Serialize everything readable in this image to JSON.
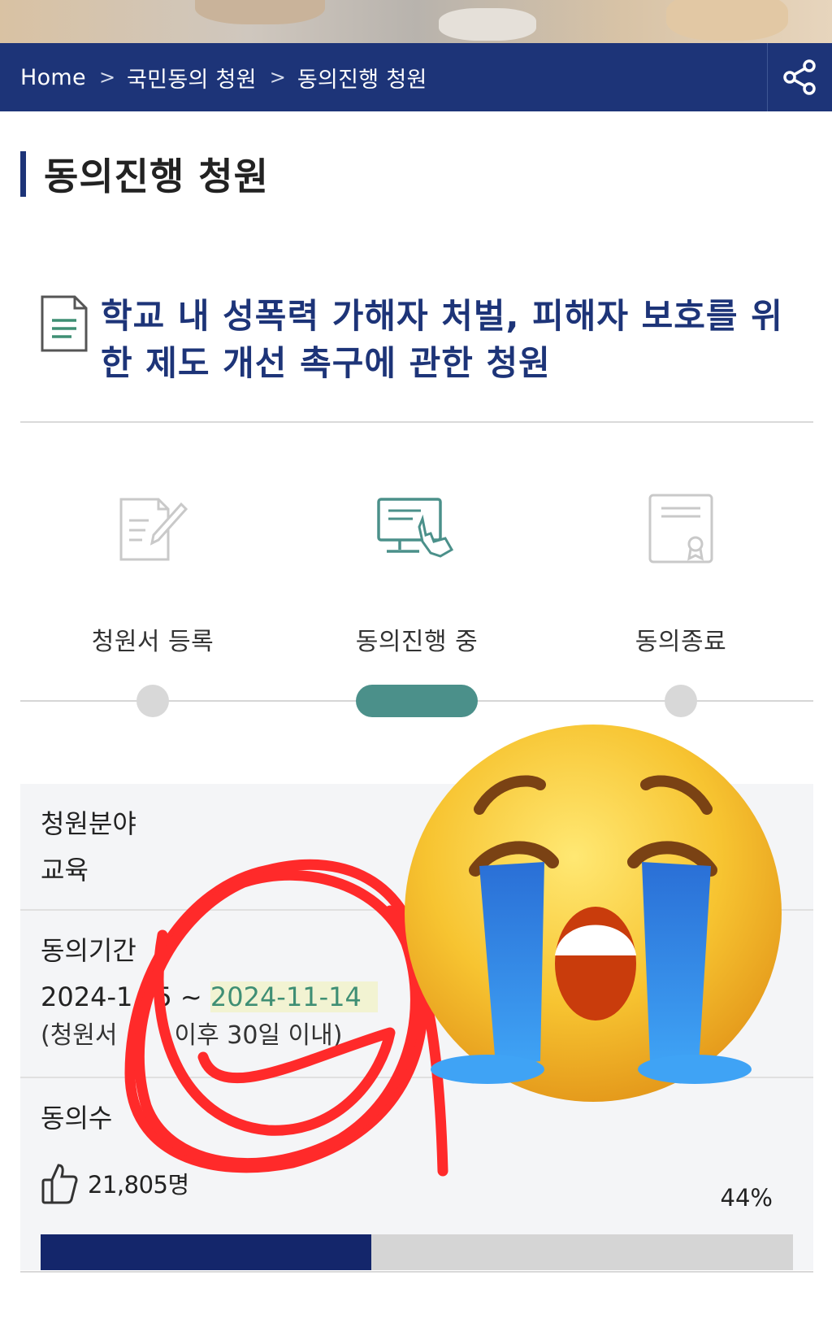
{
  "breadcrumb": {
    "items": [
      "Home",
      "국민동의 청원",
      "동의진행 청원"
    ],
    "separator": ">"
  },
  "header": {
    "share_icon": "share-icon"
  },
  "page": {
    "title": "동의진행 청원"
  },
  "petition": {
    "title": "학교 내 성폭력 가해자 처벌, 피해자 보호를 위한 제도 개선 촉구에 관한 청원",
    "icon": "document-icon"
  },
  "steps": [
    {
      "label": "청원서 등록",
      "icon": "form-pen-icon",
      "active": false
    },
    {
      "label": "동의진행 중",
      "icon": "monitor-click-icon",
      "active": true
    },
    {
      "label": "동의종료",
      "icon": "certificate-icon",
      "active": false
    }
  ],
  "info": {
    "field_label": "청원분야",
    "field_value": "교육",
    "period_label": "동의기간",
    "period_start": "2024-1",
    "period_start_tail": "5 ~ ",
    "period_end": "2024-11-14",
    "period_note_a": "(청원서",
    "period_note_b": "이후 30일 이내)",
    "count_label": "동의수",
    "count_value": "21,805명",
    "percent": "44%",
    "progress": 0.44
  },
  "colors": {
    "navy": "#1d3478",
    "teal": "#4b908a",
    "bar_fill": "#14266b",
    "scribble": "#ff2a2a"
  },
  "overlays": [
    "red-scribble-circle",
    "crying-face-emoji"
  ]
}
